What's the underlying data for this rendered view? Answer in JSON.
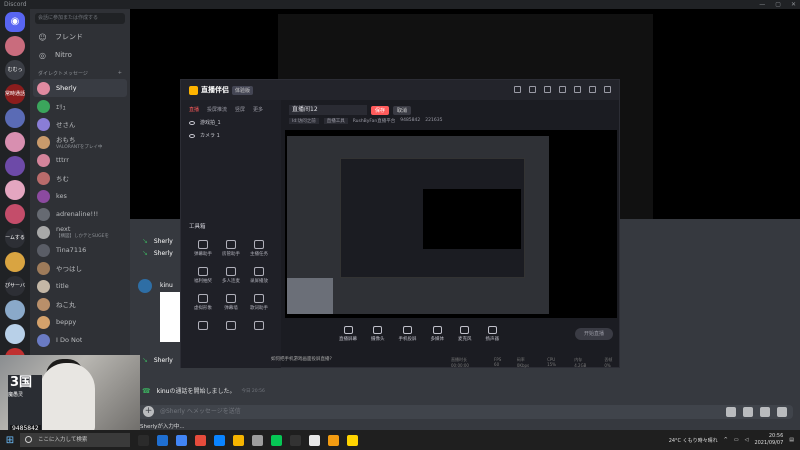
{
  "titlebar": {
    "title": "Discord",
    "controls": [
      "—",
      "▢",
      "✕"
    ]
  },
  "servers": [
    {
      "kind": "home",
      "icon": "discord-logo-icon",
      "color": "#5865f2"
    },
    {
      "label": "",
      "color": "#c96c7d"
    },
    {
      "label": "むむっ",
      "color": "#3a3d44"
    },
    {
      "label": "常時通話",
      "color": "#8b1d1d"
    },
    {
      "label": "",
      "color": "#5a6bb5"
    },
    {
      "label": "",
      "color": "#d88fb0"
    },
    {
      "label": "",
      "color": "#6d4aa8"
    },
    {
      "label": "",
      "color": "#e4a6c0"
    },
    {
      "label": "",
      "color": "#c44d6a"
    },
    {
      "label": "ームする",
      "color": "#2d2f35"
    },
    {
      "label": "",
      "color": "#d9a441"
    },
    {
      "label": "ぴサーバ",
      "color": "#2d2f35"
    },
    {
      "label": "",
      "color": "#8aa9c9"
    },
    {
      "label": "",
      "color": "#b8d0e8"
    },
    {
      "label": "",
      "color": "#c03030"
    },
    {
      "label": "",
      "color": "#a0b0e0"
    }
  ],
  "dm_list": {
    "search_placeholder": "会話に参加または作成する",
    "nav": [
      {
        "icon": "friends-icon",
        "label": "フレンド"
      },
      {
        "icon": "nitro-icon",
        "label": "Nitro"
      }
    ],
    "section_title": "ダイレクトメッセージ",
    "add_icon": "+",
    "items": [
      {
        "name": "Sherly",
        "sub": "",
        "active": true,
        "color": "#e08aa0"
      },
      {
        "name": "ｴﾘｭ",
        "sub": "",
        "color": "#3ba55c"
      },
      {
        "name": "せさん",
        "sub": "",
        "color": "#8a7dd6"
      },
      {
        "name": "おもち",
        "sub": "VALORANTをプレイ中",
        "color": "#c99a6b"
      },
      {
        "name": "tttrr",
        "sub": "",
        "color": "#d4849b"
      },
      {
        "name": "ちむ",
        "sub": "",
        "color": "#b96b6b"
      },
      {
        "name": "kes",
        "sub": "",
        "color": "#8c4aa0"
      },
      {
        "name": "adrenaline!!!",
        "sub": "",
        "color": "#666a72"
      },
      {
        "name": "next",
        "sub": "【構図】しかテとSUGEを",
        "color": "#a8a8a8"
      },
      {
        "name": "Tina7116",
        "sub": "",
        "color": "#5a5d66"
      },
      {
        "name": "やつはし",
        "sub": "",
        "color": "#9e7b5a"
      },
      {
        "name": "title",
        "sub": "",
        "color": "#c4b7a6"
      },
      {
        "name": "ねこ丸",
        "sub": "",
        "color": "#b98f6a"
      },
      {
        "name": "beppy",
        "sub": "",
        "color": "#d4a16b"
      },
      {
        "name": "I Do Not",
        "sub": "",
        "color": "#6a7bc4"
      }
    ]
  },
  "chat": {
    "messages": [
      {
        "name": "Sherly",
        "text": "",
        "time": ""
      },
      {
        "name": "Sherly",
        "text": "",
        "time": ""
      },
      {
        "name": "kinu",
        "text": "",
        "time": ""
      },
      {
        "name": "Sherly",
        "text": "",
        "time": ""
      },
      {
        "name": "kinu",
        "text": "の通話を開始しました。",
        "time": "今日 20:56"
      }
    ],
    "input_placeholder": "@Sherly へメッセージを送信",
    "typing": "Sherlyが入力中..."
  },
  "stream_app": {
    "brand": "直播伴侣",
    "version": "体验版",
    "tabs": [
      "直播",
      "投屏推流",
      "竖屏",
      "更多"
    ],
    "sources": [
      "游戏拍_1",
      "カメラ 1"
    ],
    "title_value": "直播间12",
    "title_btn_primary": "保存",
    "title_btn_secondary": "取消",
    "meta": [
      "Id:访问之前",
      "直播工具",
      "RushByFan直播平台",
      "9485842",
      "221635"
    ],
    "tools_title": "工具箱",
    "tools": [
      "弹幕助手",
      "房管助手",
      "主播任务",
      "福利抽奖",
      "多人连麦",
      "录屏播放",
      "虚拟形象",
      "弹幕墙",
      "歌词助手",
      "",
      "",
      ""
    ],
    "controls": [
      "直播屏幕",
      "摄像头",
      "手机投屏",
      "多媒体",
      "麦克风",
      "扬声器"
    ],
    "start_label": "开始直播",
    "footer": "如何把手机游戏画面投屏直播?",
    "stats": [
      "直播时长 00:00:00",
      "FPS 60",
      "码率 0Kbps",
      "CPU 15%",
      "内存 4.2GB",
      "丢帧 0%"
    ]
  },
  "webcam": {
    "big_text": "3国",
    "sub_text": "魔愚灵",
    "number": "9485842"
  },
  "taskbar": {
    "search_placeholder": "ここに入力して検索",
    "apps": [
      "#2b2b2b",
      "#1f6fd1",
      "#4285f4",
      "#e74c3c",
      "#0a84ff",
      "#f5b400",
      "#9e9e9e",
      "#06c755",
      "#333333",
      "#e8e8e8",
      "#f39c12",
      "#ffd400"
    ],
    "weather": "24°C くもり時々晴れ",
    "time": "20:56",
    "date": "2021/09/07"
  }
}
